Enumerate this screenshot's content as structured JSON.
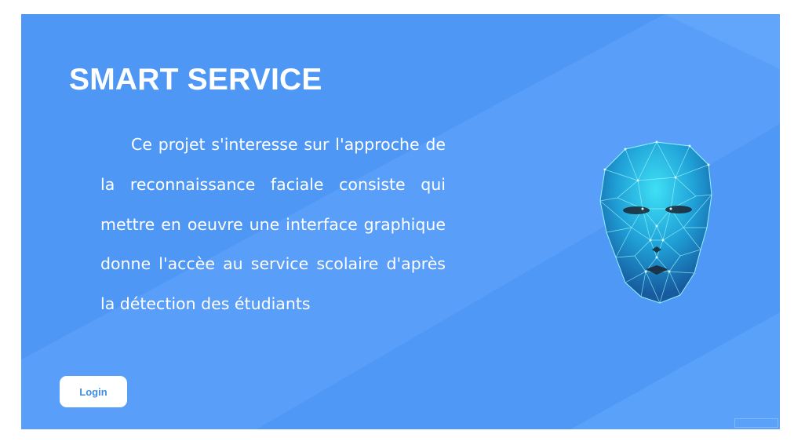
{
  "hero": {
    "title": "SMART SERVICE",
    "description": "Ce projet s'interesse sur l'approche de la reconnaissance faciale consiste qui mettre en oeuvre une interface graphique donne l'accèe au service scolaire d'après la détection des étudiants"
  },
  "actions": {
    "login_label": "Login"
  },
  "illustration": {
    "icon": "polygon-face-icon"
  },
  "colors": {
    "background": "#4f97f4",
    "text": "#ffffff",
    "button_bg": "#ffffff",
    "button_text": "#3f8ee0",
    "face_accent": "#2fd0f0"
  }
}
